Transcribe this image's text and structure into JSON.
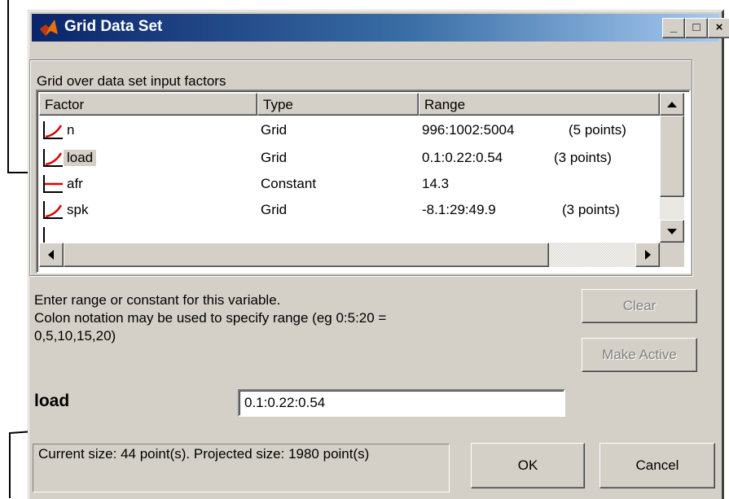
{
  "window": {
    "title": "Grid Data Set",
    "minimize": "_",
    "maximize": "□",
    "close": "×"
  },
  "group": {
    "label": "Grid over data set input factors"
  },
  "table": {
    "columns": [
      "Factor",
      "Type",
      "Range"
    ],
    "rows": [
      {
        "factor": "n",
        "type": "Grid",
        "range": "996:1002:5004",
        "points": "(5 points)",
        "icon": "graph-icon"
      },
      {
        "factor": "load",
        "type": "Grid",
        "range": "0.1:0.22:0.54",
        "points": "(3 points)",
        "icon": "graph-icon"
      },
      {
        "factor": "afr",
        "type": "Constant",
        "range": "14.3",
        "points": "",
        "icon": "constant-icon"
      },
      {
        "factor": "spk",
        "type": "Grid",
        "range": "-8.1:29:49.9",
        "points": "(3 points)",
        "icon": "graph-icon"
      }
    ]
  },
  "instructions": {
    "line1": "Enter range or constant for this variable.",
    "line2": "Colon notation may be used to specify range (eg 0:5:20 =",
    "line3": "0,5,10,15,20)"
  },
  "buttons": {
    "clear": "Clear",
    "make_active": "Make Active",
    "ok": "OK",
    "cancel": "Cancel"
  },
  "editor": {
    "variable": "load",
    "value": "0.1:0.22:0.54"
  },
  "status": {
    "text": "Current size: 44 point(s).  Projected size: 1980 point(s)"
  },
  "colors": {
    "title_start": "#0a246a",
    "title_end": "#a6caf0",
    "face": "#d4d0c8",
    "graph_red": "#e00000"
  }
}
